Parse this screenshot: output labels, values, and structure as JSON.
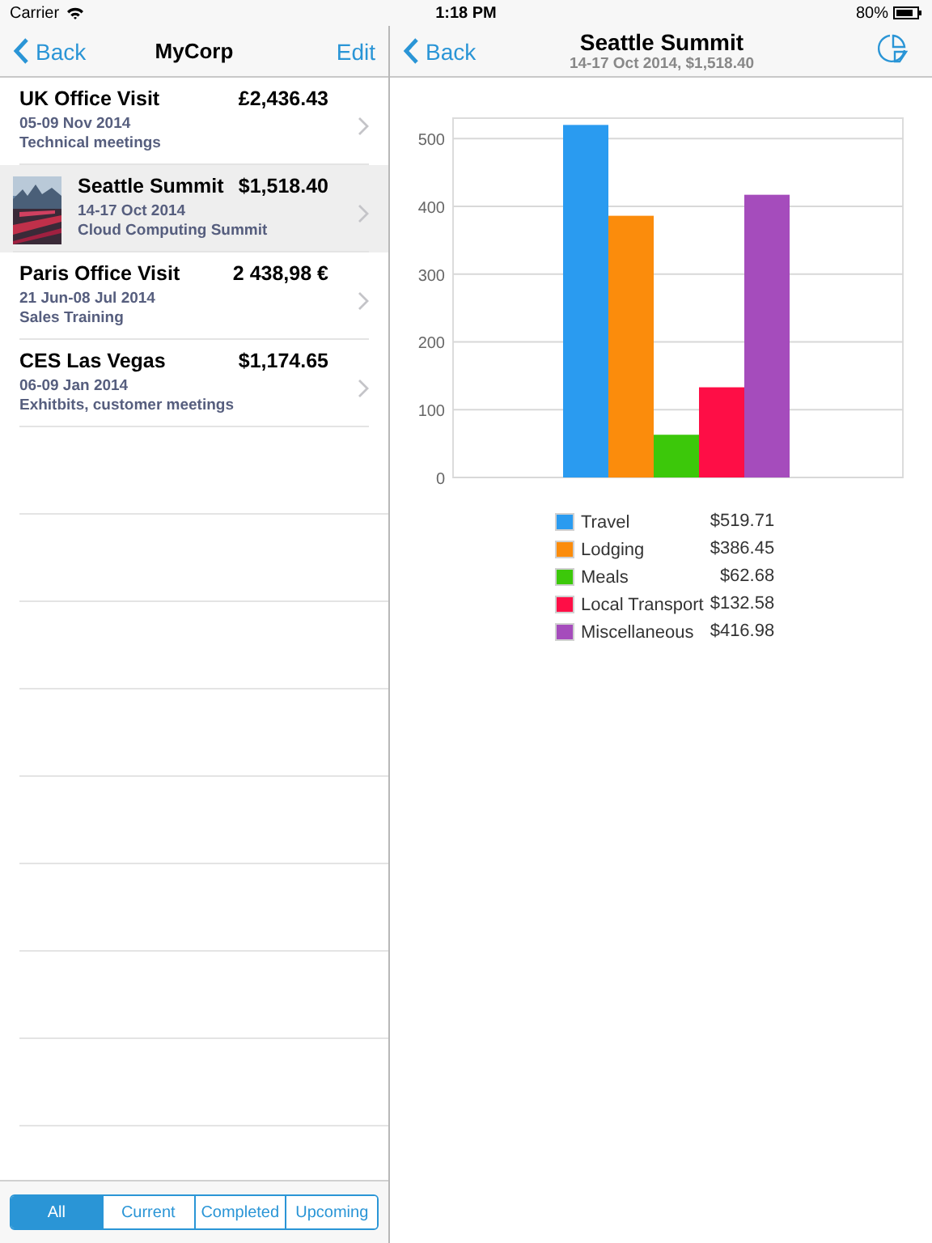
{
  "status_bar": {
    "carrier": "Carrier",
    "time": "1:18 PM",
    "battery": "80%"
  },
  "master": {
    "nav": {
      "back": "Back",
      "title": "MyCorp",
      "action": "Edit"
    },
    "trips": [
      {
        "title": "UK Office Visit",
        "amount": "£2,436.43",
        "dates": "05-09 Nov 2014",
        "note": "Technical meetings",
        "selected": false
      },
      {
        "title": "Seattle Summit",
        "amount": "$1,518.40",
        "dates": "14-17 Oct 2014",
        "note": "Cloud Computing Summit",
        "selected": true
      },
      {
        "title": "Paris Office Visit",
        "amount": "2 438,98 €",
        "dates": "21 Jun-08 Jul 2014",
        "note": "Sales Training",
        "selected": false
      },
      {
        "title": "CES Las Vegas",
        "amount": "$1,174.65",
        "dates": "06-09 Jan 2014",
        "note": "Exhitbits, customer meetings",
        "selected": false
      }
    ],
    "filters": [
      {
        "label": "All",
        "selected": true
      },
      {
        "label": "Current",
        "selected": false
      },
      {
        "label": "Completed",
        "selected": false
      },
      {
        "label": "Upcoming",
        "selected": false
      }
    ]
  },
  "detail": {
    "nav": {
      "back": "Back",
      "title": "Seattle Summit",
      "subtitle": "14-17 Oct 2014, $1,518.40"
    },
    "chart_data": {
      "type": "bar",
      "grid": true,
      "ylim": [
        0,
        530
      ],
      "yticks": [
        0,
        100,
        200,
        300,
        400,
        500
      ],
      "series": [
        {
          "name": "Travel",
          "color": "#2a9bf0",
          "values": [
            520
          ]
        },
        {
          "name": "Lodging",
          "color": "#fb8c0c",
          "values": [
            386
          ]
        },
        {
          "name": "Meals",
          "color": "#3cc80a",
          "values": [
            63
          ]
        },
        {
          "name": "Local Transport",
          "color": "#fe0e46",
          "values": [
            133
          ]
        },
        {
          "name": "Miscellaneous",
          "color": "#a54cbc",
          "values": [
            417
          ]
        }
      ]
    },
    "legend_amounts": [
      "$519.71",
      "$386.45",
      "$62.68",
      "$132.58",
      "$416.98"
    ]
  }
}
